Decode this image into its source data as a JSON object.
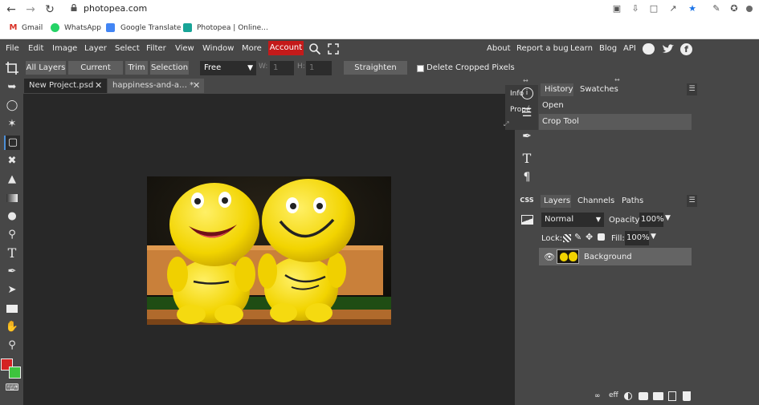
{
  "browser": {
    "url": "photopea.com",
    "bookmarks": [
      "Gmail",
      "WhatsApp",
      "Google Translate",
      "Photopea | Online..."
    ]
  },
  "menu": {
    "items": [
      "File",
      "Edit",
      "Image",
      "Layer",
      "Select",
      "Filter",
      "View",
      "Window",
      "More"
    ],
    "account": "Account",
    "right_items": [
      "About",
      "Report a bug",
      "Learn",
      "Blog",
      "API"
    ]
  },
  "options": {
    "buttons": [
      "All Layers",
      "Current Layer",
      "Trim",
      "Selection"
    ],
    "ratio_select": "Free",
    "w_label": "W:",
    "w_value": "1",
    "h_label": "H:",
    "h_value": "1",
    "straighten": "Straighten Layer",
    "delete_cropped": "Delete Cropped Pixels"
  },
  "tabs": [
    {
      "label": "New Project.psd",
      "close": "✕"
    },
    {
      "label": "happiness-and-a… *",
      "close": "✕"
    }
  ],
  "mini_panel": {
    "info": "Info",
    "props": "Propé"
  },
  "history": {
    "tabs": [
      "History",
      "Swatches"
    ],
    "items": [
      "Open",
      "Crop Tool"
    ]
  },
  "layers_panel": {
    "tabs": [
      "Layers",
      "Channels",
      "Paths"
    ],
    "blend": "Normal",
    "opacity_label": "Opacity:",
    "opacity": "100%",
    "lock_label": "Lock:",
    "fill_label": "Fill:",
    "fill": "100%",
    "layer_name": "Background"
  },
  "colors": {
    "foreground": "#d42323",
    "background": "#3ec43e",
    "accent": "#c41a1a"
  },
  "icons": [
    "back-icon",
    "forward-icon",
    "reload-icon",
    "search-icon",
    "fullscreen-icon",
    "reddit-icon",
    "twitter-icon",
    "facebook-icon",
    "eye-icon"
  ]
}
